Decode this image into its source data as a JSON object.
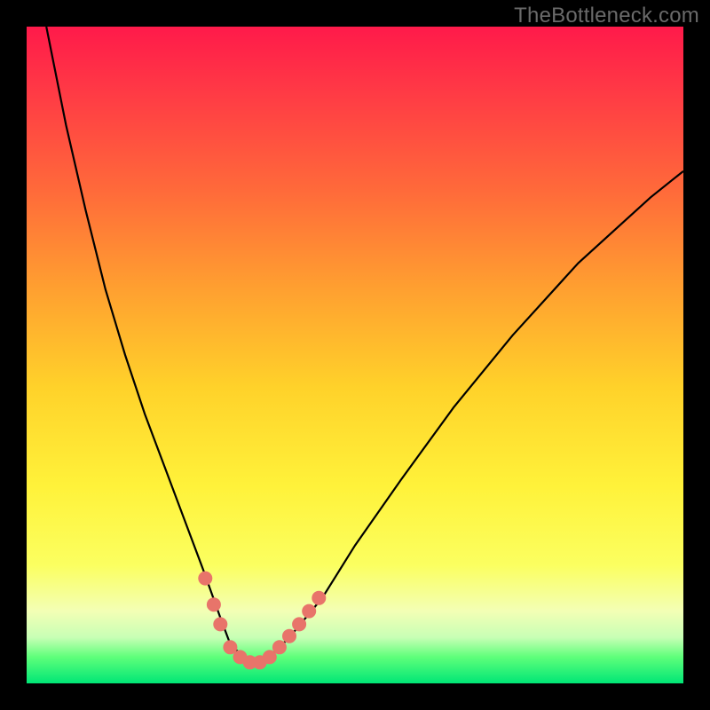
{
  "watermark": "TheBottleneck.com",
  "chart_data": {
    "type": "line",
    "title": "",
    "xlabel": "",
    "ylabel": "",
    "xlim": [
      0,
      100
    ],
    "ylim": [
      0,
      100
    ],
    "series": [
      {
        "name": "bottleneck-curve",
        "x": [
          3,
          6,
          9,
          12,
          15,
          18,
          21,
          24,
          27,
          29.5,
          31,
          33,
          35,
          37,
          40,
          45,
          50,
          57,
          65,
          74,
          84,
          95,
          100
        ],
        "values": [
          100,
          85,
          72,
          60,
          50,
          41,
          33,
          25,
          17,
          10,
          6,
          4,
          3,
          4,
          7,
          13,
          21,
          31,
          42,
          53,
          64,
          74,
          78
        ]
      }
    ],
    "markers": [
      {
        "name": "dot-left-upper",
        "x": 27.2,
        "y": 16
      },
      {
        "name": "dot-left-1",
        "x": 28.5,
        "y": 12
      },
      {
        "name": "dot-left-2",
        "x": 29.5,
        "y": 9
      },
      {
        "name": "dot-bottom-1",
        "x": 31,
        "y": 5.5
      },
      {
        "name": "dot-bottom-2",
        "x": 32.5,
        "y": 4
      },
      {
        "name": "dot-bottom-3",
        "x": 34,
        "y": 3.2
      },
      {
        "name": "dot-bottom-4",
        "x": 35.5,
        "y": 3.2
      },
      {
        "name": "dot-bottom-5",
        "x": 37,
        "y": 4
      },
      {
        "name": "dot-right-1",
        "x": 38.5,
        "y": 5.5
      },
      {
        "name": "dot-right-2",
        "x": 40,
        "y": 7.2
      },
      {
        "name": "dot-right-3",
        "x": 41.5,
        "y": 9
      },
      {
        "name": "dot-right-4",
        "x": 43,
        "y": 11
      },
      {
        "name": "dot-right-5",
        "x": 44.5,
        "y": 13
      }
    ],
    "marker_color": "#e8746a",
    "curve_color": "#000000",
    "gradient_stops": [
      {
        "pos": 0,
        "color": "#ff1a4a"
      },
      {
        "pos": 10,
        "color": "#ff3a45"
      },
      {
        "pos": 25,
        "color": "#ff6a3a"
      },
      {
        "pos": 40,
        "color": "#ffa030"
      },
      {
        "pos": 55,
        "color": "#ffd22a"
      },
      {
        "pos": 70,
        "color": "#fff23a"
      },
      {
        "pos": 82,
        "color": "#fbff60"
      },
      {
        "pos": 89,
        "color": "#f3ffb5"
      },
      {
        "pos": 93,
        "color": "#c8ffb5"
      },
      {
        "pos": 96,
        "color": "#5eff7a"
      },
      {
        "pos": 100,
        "color": "#00e676"
      }
    ]
  }
}
